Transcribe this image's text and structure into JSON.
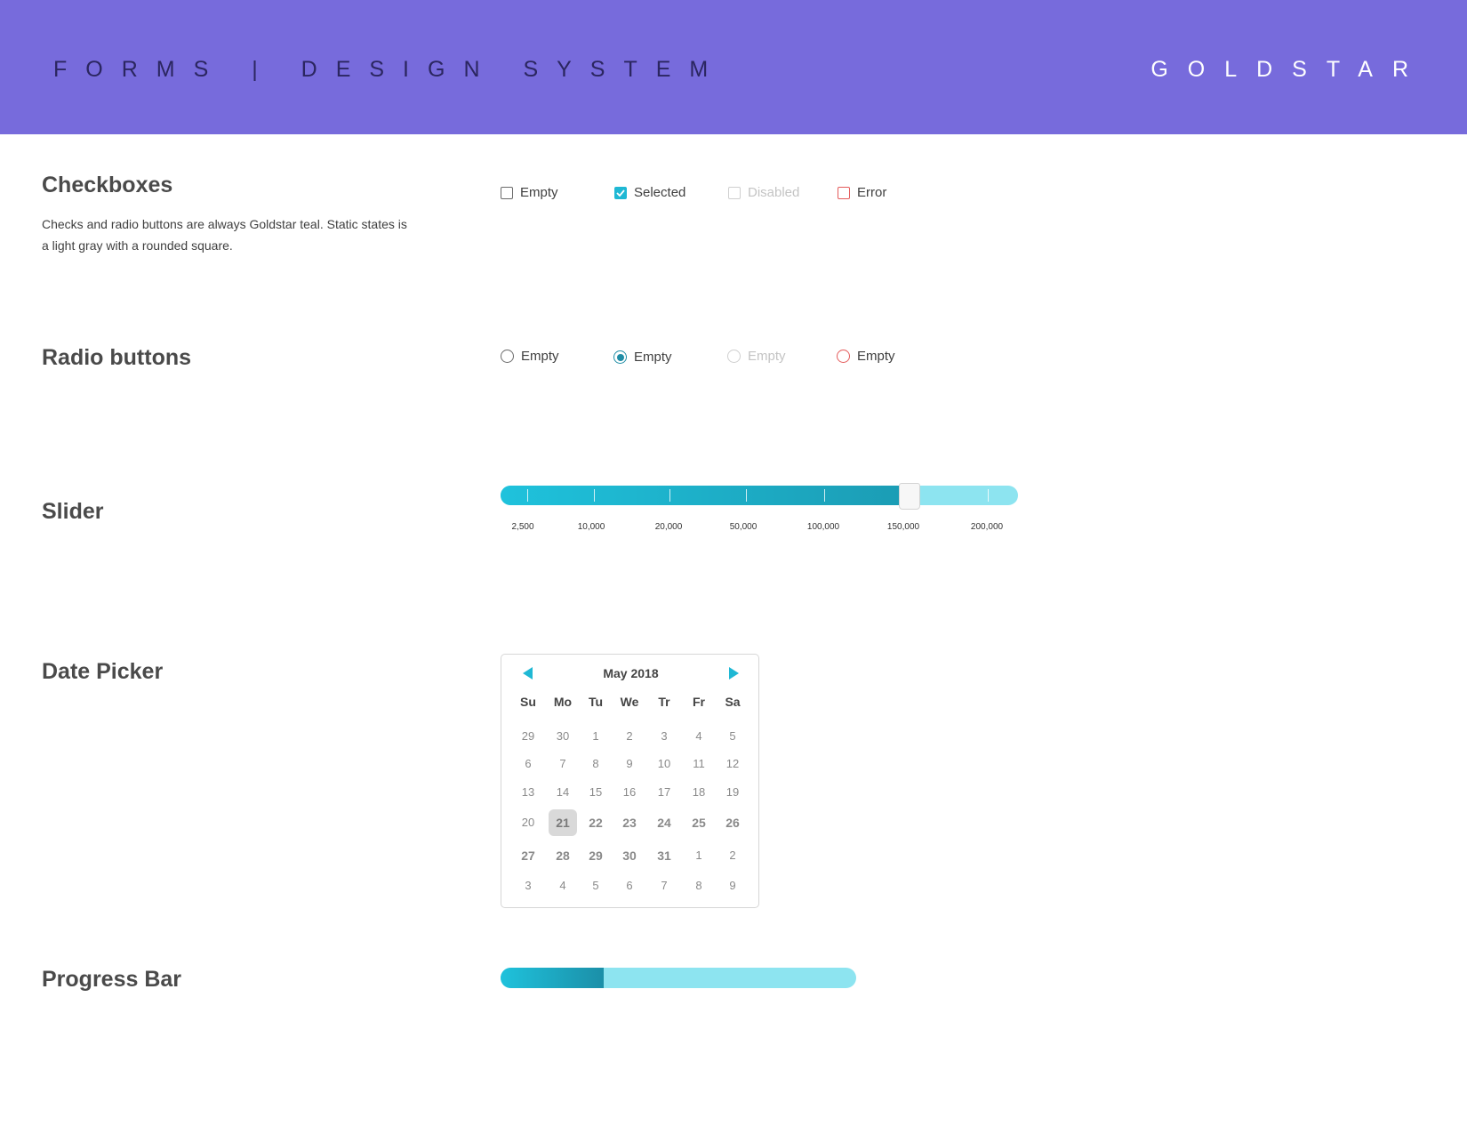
{
  "header": {
    "title": "FORMS | DESIGN SYSTEM",
    "brand": "GOLDSTAR"
  },
  "checkboxes": {
    "title": "Checkboxes",
    "description": "Checks and radio buttons are always Goldstar teal. Static states is a light gray with a rounded square.",
    "options": [
      {
        "label": "Empty",
        "state": "empty"
      },
      {
        "label": "Selected",
        "state": "selected"
      },
      {
        "label": "Disabled",
        "state": "disabled"
      },
      {
        "label": "Error",
        "state": "error"
      }
    ]
  },
  "radios": {
    "title": "Radio buttons",
    "options": [
      {
        "label": "Empty",
        "state": "empty"
      },
      {
        "label": "Empty",
        "state": "selected"
      },
      {
        "label": "Empty",
        "state": "disabled"
      },
      {
        "label": "Empty",
        "state": "error"
      }
    ]
  },
  "slider": {
    "title": "Slider",
    "labels": [
      "2,500",
      "10,000",
      "20,000",
      "50,000",
      "100,000",
      "150,000",
      "200,000"
    ],
    "value_label": "150,000",
    "value_fraction": 0.79
  },
  "datepicker": {
    "title": "Date Picker",
    "month": "May 2018",
    "weekdays": [
      "Su",
      "Mo",
      "Tu",
      "We",
      "Tr",
      "Fr",
      "Sa"
    ],
    "weeks": [
      [
        "29",
        "30",
        "1",
        "2",
        "3",
        "4",
        "5"
      ],
      [
        "6",
        "7",
        "8",
        "9",
        "10",
        "11",
        "12"
      ],
      [
        "13",
        "14",
        "15",
        "16",
        "17",
        "18",
        "19"
      ],
      [
        "20",
        "21",
        "22",
        "23",
        "24",
        "25",
        "26"
      ],
      [
        "27",
        "28",
        "29",
        "30",
        "31",
        "1",
        "2"
      ],
      [
        "3",
        "4",
        "5",
        "6",
        "7",
        "8",
        "9"
      ]
    ],
    "selected_day": "21"
  },
  "progress": {
    "title": "Progress Bar",
    "value_fraction": 0.29
  },
  "colors": {
    "header": "#776bdc",
    "teal": "#1fb8d4",
    "teal_light": "#8de4f0",
    "error": "#e45b5b"
  }
}
